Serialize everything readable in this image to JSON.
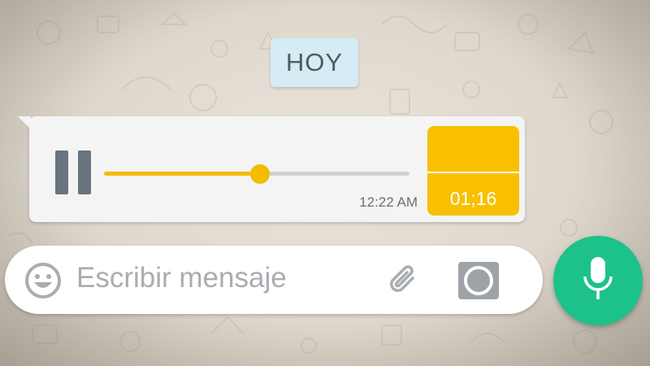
{
  "date_divider": {
    "label": "HOY"
  },
  "voice_message": {
    "timestamp": "12:22 AM",
    "duration": "01;16",
    "progress": 0.51,
    "colors": {
      "accent": "#f3bc00",
      "control": "#687480",
      "bubble": "#f4f4f4"
    }
  },
  "composer": {
    "placeholder": "Escribir mensaje",
    "icons": {
      "emoji": "smiley-icon",
      "attach": "paperclip-icon",
      "camera": "camera-icon",
      "mic": "microphone-icon"
    }
  },
  "mic_button": {
    "color": "#1cc28a"
  }
}
